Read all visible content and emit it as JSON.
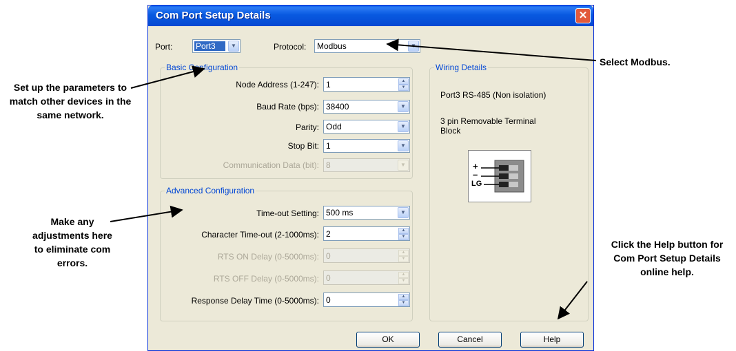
{
  "dialog": {
    "title": "Com Port Setup Details",
    "close_glyph": "✕"
  },
  "port": {
    "label": "Port:",
    "value": "Port3"
  },
  "protocol": {
    "label": "Protocol:",
    "value": "Modbus"
  },
  "basic": {
    "legend": "Basic Configuration",
    "node_address": {
      "label": "Node Address (1-247):",
      "value": "1"
    },
    "baud_rate": {
      "label": "Baud Rate (bps):",
      "value": "38400"
    },
    "parity": {
      "label": "Parity:",
      "value": "Odd"
    },
    "stop_bit": {
      "label": "Stop Bit:",
      "value": "1"
    },
    "comm_data": {
      "label": "Communication Data (bit):",
      "value": "8"
    }
  },
  "advanced": {
    "legend": "Advanced Configuration",
    "timeout": {
      "label": "Time-out Setting:",
      "value": "500 ms"
    },
    "char_timeout": {
      "label": "Character Time-out (2-1000ms):",
      "value": "2"
    },
    "rts_on": {
      "label": "RTS ON Delay (0-5000ms):",
      "value": "0"
    },
    "rts_off": {
      "label": "RTS OFF Delay (0-5000ms):",
      "value": "0"
    },
    "response_delay": {
      "label": "Response Delay Time (0-5000ms):",
      "value": "0"
    }
  },
  "wiring": {
    "legend": "Wiring Details",
    "port_info": "Port3 RS-485 (Non isolation)",
    "terminal_info": "3 pin Removable Terminal Block",
    "pin_plus": "+",
    "pin_minus": "–",
    "pin_lg": "LG"
  },
  "buttons": {
    "ok": "OK",
    "cancel": "Cancel",
    "help": "Help"
  },
  "callouts": {
    "select_modbus": "Select Modbus.",
    "set_params": "Set up the parameters to match other devices in the same network.",
    "adjustments": "Make any adjustments here to eliminate com errors.",
    "help": "Click the Help button for Com Port Setup Details online help."
  },
  "colors": {
    "title_bar": "#0a5ee8",
    "legend_text": "#0046d5",
    "dialog_bg": "#ece9d8",
    "close_button": "#e25a3c"
  }
}
